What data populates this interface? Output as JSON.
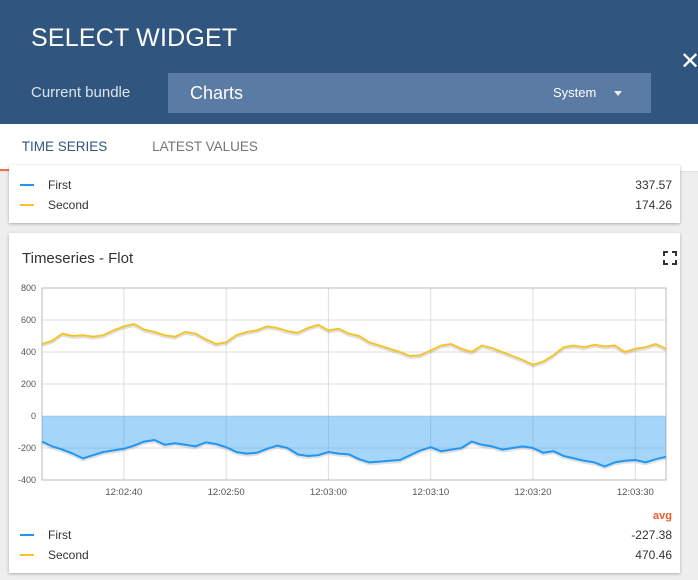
{
  "header": {
    "title": "SELECT WIDGET",
    "bundle_label": "Current bundle",
    "bundle_name": "Charts",
    "bundle_scope": "System"
  },
  "tabs": [
    {
      "label": "TIME SERIES",
      "active": true
    },
    {
      "label": "LATEST VALUES",
      "active": false
    }
  ],
  "colors": {
    "header": "#305680",
    "accent": "#ff7043",
    "series_first": "#2196f3",
    "series_second": "#f4c430"
  },
  "icons": {
    "close": "close-icon",
    "fullscreen": "fullscreen-icon",
    "dropdown": "chevron-down-icon"
  },
  "card_top": {
    "legend": [
      {
        "name": "First",
        "value": "337.57",
        "color": "#2196f3"
      },
      {
        "name": "Second",
        "value": "174.26",
        "color": "#f4c430"
      }
    ]
  },
  "card_chart": {
    "title": "Timeseries - Flot",
    "avg_label": "avg",
    "legend": [
      {
        "name": "First",
        "value": "-227.38",
        "color": "#2196f3"
      },
      {
        "name": "Second",
        "value": "470.46",
        "color": "#f4c430"
      }
    ]
  },
  "chart_data": {
    "type": "line",
    "title": "Timeseries - Flot",
    "xlabel": "",
    "ylabel": "",
    "ylim": [
      -400,
      800
    ],
    "y_ticks": [
      800,
      600,
      400,
      200,
      0,
      -200,
      -400
    ],
    "x_ticks": [
      "12:02:40",
      "12:02:50",
      "12:03:00",
      "12:03:10",
      "12:03:20",
      "12:03:30"
    ],
    "x_tick_seconds": [
      160,
      170,
      180,
      190,
      200,
      210
    ],
    "xlim_seconds": [
      152,
      213
    ],
    "grid": true,
    "legend": "bottom",
    "series": [
      {
        "name": "First",
        "color": "#2196f3",
        "fill_to_zero": true,
        "x_seconds": [
          152,
          153,
          154,
          155,
          156,
          157,
          158,
          159,
          160,
          161,
          162,
          163,
          164,
          165,
          166,
          167,
          168,
          169,
          170,
          171,
          172,
          173,
          174,
          175,
          176,
          177,
          178,
          179,
          180,
          181,
          182,
          183,
          184,
          185,
          186,
          187,
          188,
          189,
          190,
          191,
          192,
          193,
          194,
          195,
          196,
          197,
          198,
          199,
          200,
          201,
          202,
          203,
          204,
          205,
          206,
          207,
          208,
          209,
          210,
          211,
          212,
          213
        ],
        "values": [
          -160,
          -190,
          -210,
          -235,
          -265,
          -245,
          -225,
          -215,
          -205,
          -185,
          -160,
          -150,
          -180,
          -170,
          -180,
          -190,
          -165,
          -175,
          -195,
          -225,
          -235,
          -230,
          -205,
          -185,
          -200,
          -240,
          -250,
          -245,
          -225,
          -235,
          -240,
          -270,
          -290,
          -285,
          -280,
          -275,
          -245,
          -215,
          -195,
          -220,
          -210,
          -200,
          -160,
          -180,
          -190,
          -210,
          -200,
          -190,
          -200,
          -230,
          -220,
          -250,
          -265,
          -280,
          -290,
          -315,
          -290,
          -280,
          -275,
          -290,
          -270,
          -255
        ]
      },
      {
        "name": "Second",
        "color": "#f4c430",
        "fill_to_zero": false,
        "x_seconds": [
          152,
          153,
          154,
          155,
          156,
          157,
          158,
          159,
          160,
          161,
          162,
          163,
          164,
          165,
          166,
          167,
          168,
          169,
          170,
          171,
          172,
          173,
          174,
          175,
          176,
          177,
          178,
          179,
          180,
          181,
          182,
          183,
          184,
          185,
          186,
          187,
          188,
          189,
          190,
          191,
          192,
          193,
          194,
          195,
          196,
          197,
          198,
          199,
          200,
          201,
          202,
          203,
          204,
          205,
          206,
          207,
          208,
          209,
          210,
          211,
          212,
          213
        ],
        "values": [
          450,
          470,
          515,
          500,
          505,
          495,
          505,
          535,
          560,
          575,
          540,
          525,
          505,
          495,
          525,
          515,
          480,
          450,
          460,
          505,
          525,
          535,
          560,
          550,
          530,
          520,
          550,
          570,
          535,
          545,
          515,
          500,
          460,
          440,
          420,
          400,
          375,
          380,
          410,
          440,
          450,
          420,
          400,
          440,
          425,
          400,
          375,
          350,
          320,
          340,
          380,
          430,
          440,
          430,
          445,
          435,
          440,
          400,
          420,
          430,
          450,
          420
        ]
      }
    ]
  }
}
